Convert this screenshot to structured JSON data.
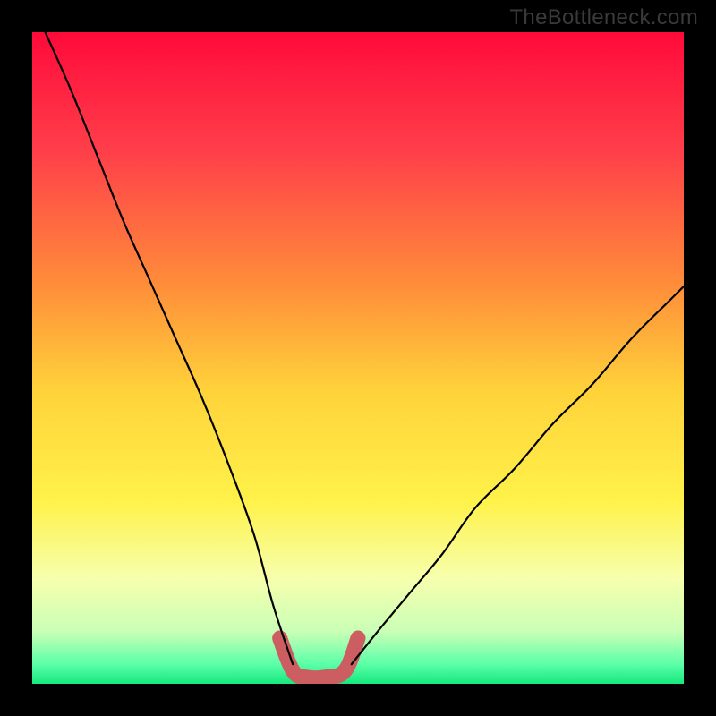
{
  "watermark": "TheBottleneck.com",
  "chart_data": {
    "type": "line",
    "title": "",
    "xlabel": "",
    "ylabel": "",
    "xlim": [
      0,
      100
    ],
    "ylim": [
      0,
      100
    ],
    "gradient_stops": [
      {
        "offset": 0,
        "color": "#ff0a3a"
      },
      {
        "offset": 18,
        "color": "#ff3e4a"
      },
      {
        "offset": 38,
        "color": "#ff8a3a"
      },
      {
        "offset": 55,
        "color": "#ffd23a"
      },
      {
        "offset": 72,
        "color": "#fff24a"
      },
      {
        "offset": 84,
        "color": "#f6ffae"
      },
      {
        "offset": 92,
        "color": "#c9ffb6"
      },
      {
        "offset": 97,
        "color": "#5bffa8"
      },
      {
        "offset": 100,
        "color": "#15e97e"
      }
    ],
    "series": [
      {
        "name": "left-branch",
        "style": "thin-black",
        "x": [
          2,
          6,
          10,
          14,
          18,
          22,
          26,
          30,
          34,
          37,
          40
        ],
        "y": [
          100,
          91,
          81,
          71,
          62,
          53,
          44,
          34,
          23,
          12,
          3
        ]
      },
      {
        "name": "right-branch",
        "style": "thin-black",
        "x": [
          49,
          53,
          58,
          63,
          68,
          74,
          80,
          86,
          92,
          98,
          100
        ],
        "y": [
          3,
          8,
          14,
          20,
          27,
          33,
          40,
          46,
          53,
          59,
          61
        ]
      },
      {
        "name": "valley-highlight",
        "style": "thick-pink",
        "x": [
          38,
          40,
          42,
          45,
          48,
          50
        ],
        "y": [
          7,
          2,
          1,
          1,
          2,
          7
        ]
      }
    ]
  }
}
